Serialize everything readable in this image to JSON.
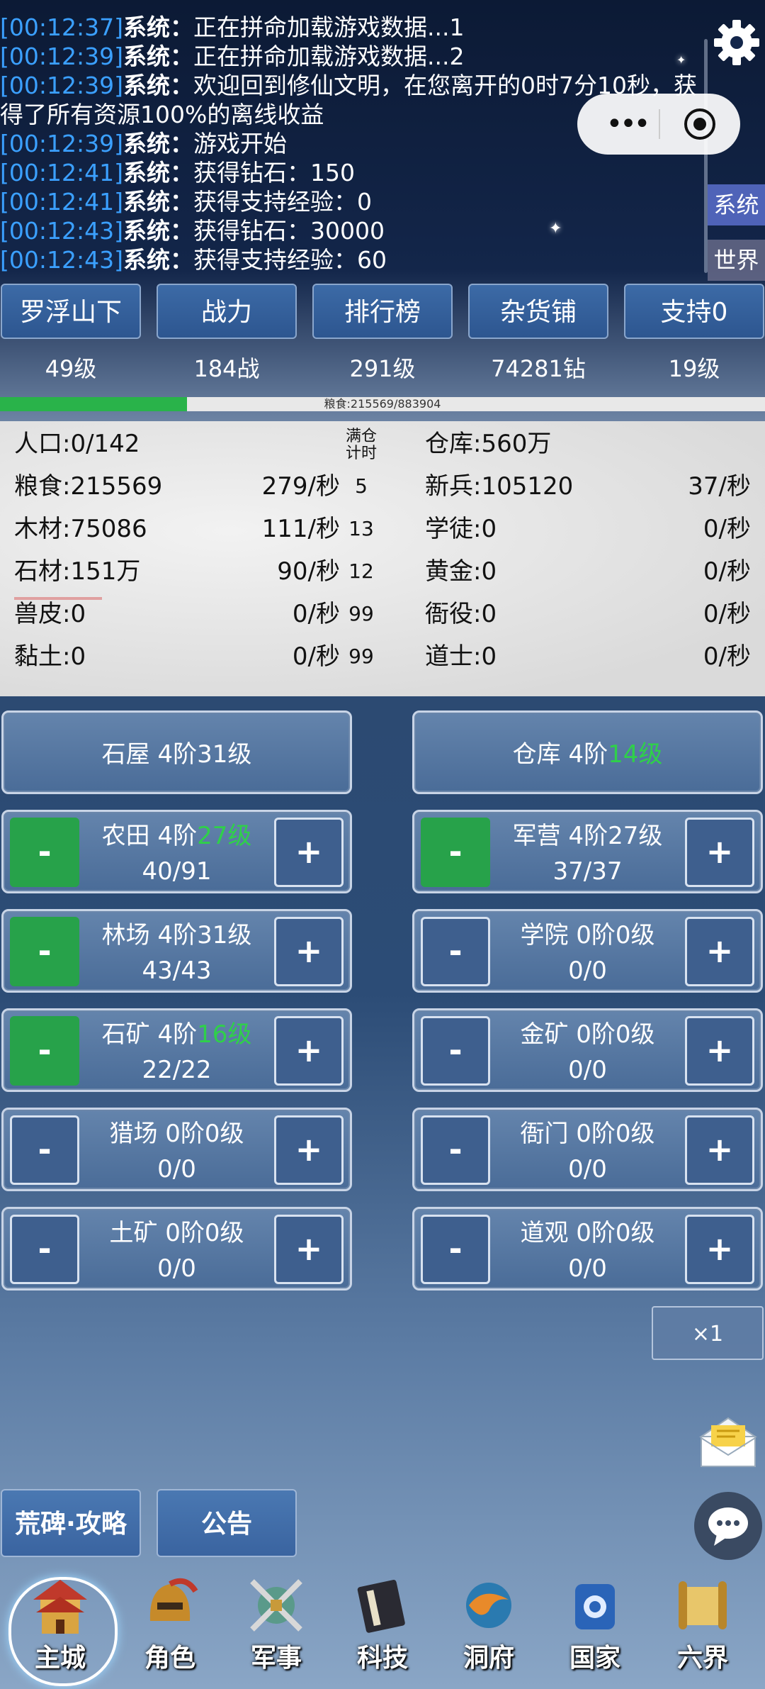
{
  "log": [
    {
      "time": "[00:12:37]",
      "sys": "系统：",
      "text": "正在拼命加载游戏数据...1"
    },
    {
      "time": "[00:12:39]",
      "sys": "系统：",
      "text": "正在拼命加载游戏数据...2"
    },
    {
      "time": "[00:12:39]",
      "sys": "系统：",
      "text": "欢迎回到修仙文明，在您离开的0时7分10秒，获得了所有资源100%的离线收益"
    },
    {
      "time": "[00:12:39]",
      "sys": "系统：",
      "text": "游戏开始"
    },
    {
      "time": "[00:12:41]",
      "sys": "系统：",
      "text": "获得钻石：150"
    },
    {
      "time": "[00:12:41]",
      "sys": "系统：",
      "text": "获得支持经验：0"
    },
    {
      "time": "[00:12:43]",
      "sys": "系统：",
      "text": "获得钻石：30000"
    },
    {
      "time": "[00:12:43]",
      "sys": "系统：",
      "text": "获得支持经验：60"
    }
  ],
  "side_tabs": {
    "system": "系统",
    "world": "世界"
  },
  "nav": [
    {
      "label": "罗浮山下",
      "value": "49级"
    },
    {
      "label": "战力",
      "value": "184战"
    },
    {
      "label": "排行榜",
      "value": "291级"
    },
    {
      "label": "杂货铺",
      "value": "74281钻"
    },
    {
      "label": "支持0",
      "value": "19级"
    }
  ],
  "grain_bar": {
    "text": "粮食:215569/883904",
    "fraction": 0.244
  },
  "resources": {
    "full_header": "满仓计时",
    "rows": [
      {
        "name": "人口:0/142",
        "rate": "",
        "full": "",
        "name2": "仓库:560万",
        "rate2": ""
      },
      {
        "name": "粮食:215569",
        "rate": "279/秒",
        "full": "5",
        "name2": "新兵:105120",
        "rate2": "37/秒"
      },
      {
        "name": "木材:75086",
        "rate": "111/秒",
        "full": "13",
        "name2": "学徒:0",
        "rate2": "0/秒"
      },
      {
        "name": "石材:151万",
        "rate": "90/秒",
        "full": "12",
        "name2": "黄金:0",
        "rate2": "0/秒"
      },
      {
        "name": "兽皮:0",
        "rate": "0/秒",
        "full": "99",
        "name2": "衙役:0",
        "rate2": "0/秒"
      },
      {
        "name": "黏土:0",
        "rate": "0/秒",
        "full": "99",
        "name2": "道士:0",
        "rate2": "0/秒"
      }
    ]
  },
  "buildings": {
    "stone_house": {
      "name": "石屋 4阶31级"
    },
    "warehouse": {
      "name": "仓库 4阶",
      "lvl": "14级"
    },
    "farm": {
      "name": "农田 4阶",
      "lvl": "27级",
      "count": "40/91"
    },
    "barracks": {
      "name": "军营 4阶27级",
      "count": "37/37"
    },
    "lumber": {
      "name": "林场 4阶31级",
      "count": "43/43"
    },
    "academy": {
      "name": "学院 0阶0级",
      "count": "0/0"
    },
    "quarry": {
      "name": "石矿 4阶",
      "lvl": "16级",
      "count": "22/22"
    },
    "gold_mine": {
      "name": "金矿 0阶0级",
      "count": "0/0"
    },
    "hunting": {
      "name": "猎场 0阶0级",
      "count": "0/0"
    },
    "yamen": {
      "name": "衙门 0阶0级",
      "count": "0/0"
    },
    "clay_mine": {
      "name": "土矿 0阶0级",
      "count": "0/0"
    },
    "temple": {
      "name": "道观 0阶0级",
      "count": "0/0"
    },
    "minus": "-",
    "plus": "+"
  },
  "multiplier": "×1",
  "bottom_buttons": {
    "guide": "荒碑·攻略",
    "notice": "公告"
  },
  "tabs": [
    {
      "label": "主城",
      "icon": "castle-icon"
    },
    {
      "label": "角色",
      "icon": "helmet-icon"
    },
    {
      "label": "军事",
      "icon": "crossed-swords-icon"
    },
    {
      "label": "科技",
      "icon": "book-icon"
    },
    {
      "label": "洞府",
      "icon": "orb-icon"
    },
    {
      "label": "国家",
      "icon": "emblem-icon"
    },
    {
      "label": "六界",
      "icon": "scroll-icon"
    }
  ],
  "colors": {
    "time": "#3ba0ff",
    "level_green": "#2fd04a",
    "active_minus": "#27a24a",
    "grain_fill": "#29b34a"
  }
}
